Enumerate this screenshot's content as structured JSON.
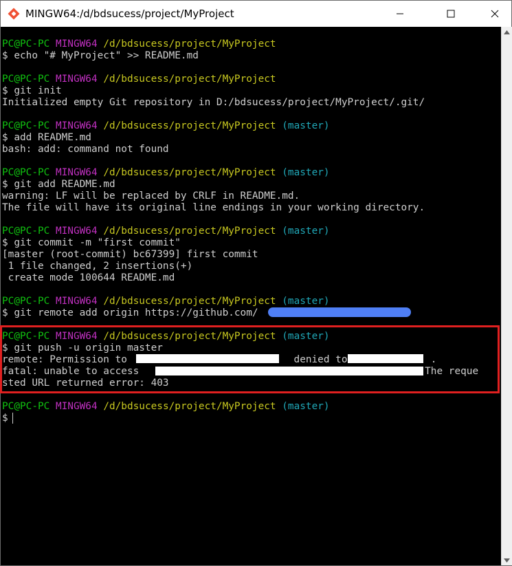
{
  "window": {
    "title": "MINGW64:/d/bdsucess/project/MyProject",
    "controls": [
      "minimize",
      "maximize",
      "close"
    ]
  },
  "terminal": {
    "prompt": {
      "user": "PC@PC-PC",
      "shell": "MINGW64",
      "path": "/d/bdsucess/project/MyProject",
      "branch": "(master)"
    },
    "blocks": [
      {
        "has_branch": false,
        "command": "$ echo \"# MyProject\" >> README.md",
        "output": []
      },
      {
        "has_branch": false,
        "command": "$ git init",
        "output": [
          "Initialized empty Git repository in D:/bdsucess/project/MyProject/.git/"
        ]
      },
      {
        "has_branch": true,
        "command": "$ add README.md",
        "output": [
          "bash: add: command not found"
        ]
      },
      {
        "has_branch": true,
        "command": "$ git add README.md",
        "output": [
          "warning: LF will be replaced by CRLF in README.md.",
          "The file will have its original line endings in your working directory."
        ]
      },
      {
        "has_branch": true,
        "command": "$ git commit -m \"first commit\"",
        "output": [
          "[master (root-commit) bc67399] first commit",
          " 1 file changed, 2 insertions(+)",
          " create mode 100644 README.md"
        ]
      },
      {
        "has_branch": true,
        "command": "$ git remote add origin https://github.com/",
        "output": []
      },
      {
        "has_branch": true,
        "command": "$ git push -u origin master",
        "output": [
          "remote: Permission to                            denied to              .",
          "fatal: unable to access                                              : The reque",
          "sted URL returned error: 403"
        ]
      },
      {
        "has_branch": true,
        "command": "$ ",
        "output": []
      }
    ]
  },
  "colors": {
    "user": "#10c210",
    "shell": "#c030c0",
    "path": "#c8c820",
    "branch": "#20a8b8",
    "text": "#cfcfcf",
    "highlight_border": "#e02020",
    "redaction_blue": "#4f7ff5"
  }
}
